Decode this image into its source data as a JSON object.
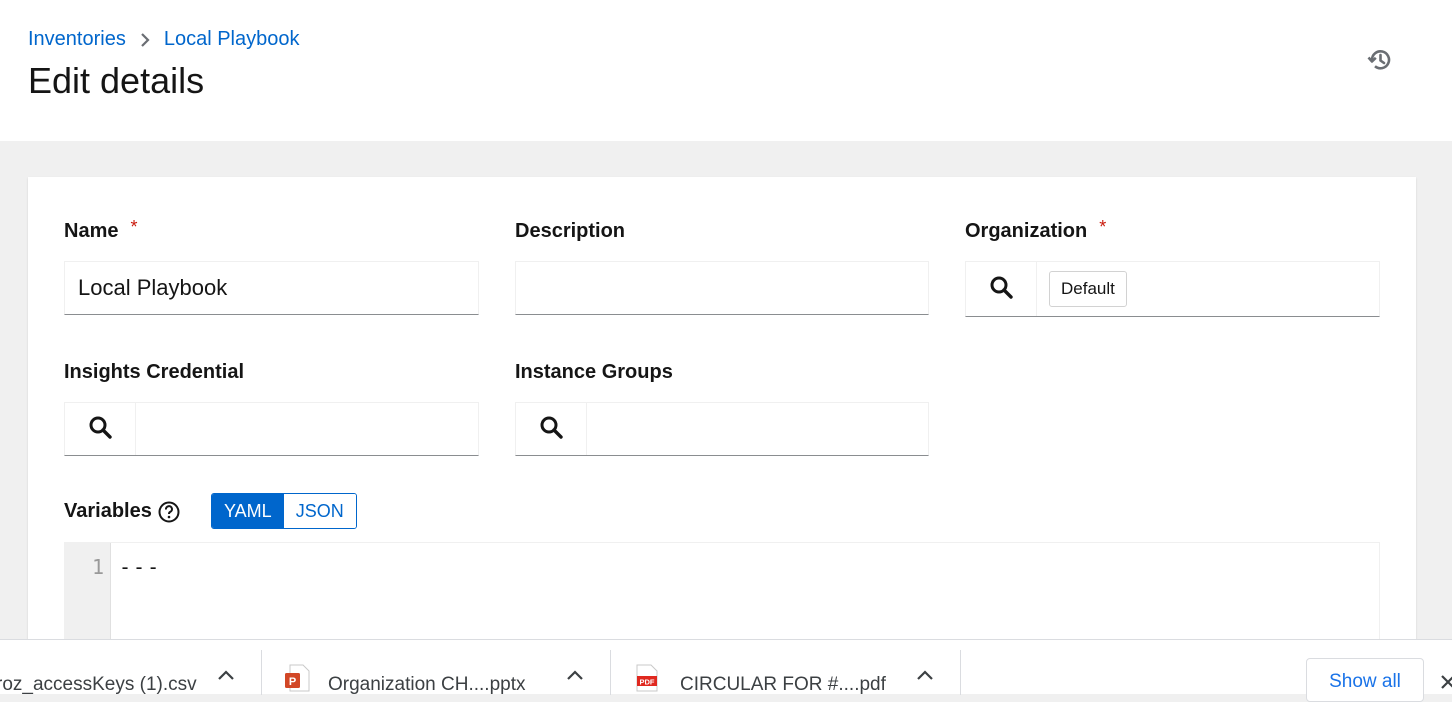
{
  "breadcrumb": {
    "items": [
      "Inventories",
      "Local Playbook"
    ]
  },
  "page": {
    "title": "Edit details"
  },
  "form": {
    "name": {
      "label": "Name",
      "required_mark": "*",
      "value": "Local Playbook"
    },
    "description": {
      "label": "Description",
      "value": ""
    },
    "organization": {
      "label": "Organization",
      "required_mark": "*",
      "chip": "Default"
    },
    "insights_credential": {
      "label": "Insights Credential"
    },
    "instance_groups": {
      "label": "Instance Groups"
    },
    "variables": {
      "label": "Variables",
      "toggle": [
        "YAML",
        "JSON"
      ],
      "active_toggle": "YAML",
      "editor": {
        "line_number": "1",
        "content": "---"
      }
    }
  },
  "downloads": {
    "items": [
      {
        "name": "roz_accessKeys (1).csv",
        "icon": "csv-file-icon"
      },
      {
        "name": "Organization CH....pptx",
        "icon": "powerpoint-file-icon"
      },
      {
        "name": "CIRCULAR FOR #....pdf",
        "icon": "pdf-file-icon"
      }
    ],
    "show_all": "Show all"
  },
  "colors": {
    "link": "#0066cc",
    "required": "#c9190b",
    "toggle_active": "#0066cc"
  }
}
